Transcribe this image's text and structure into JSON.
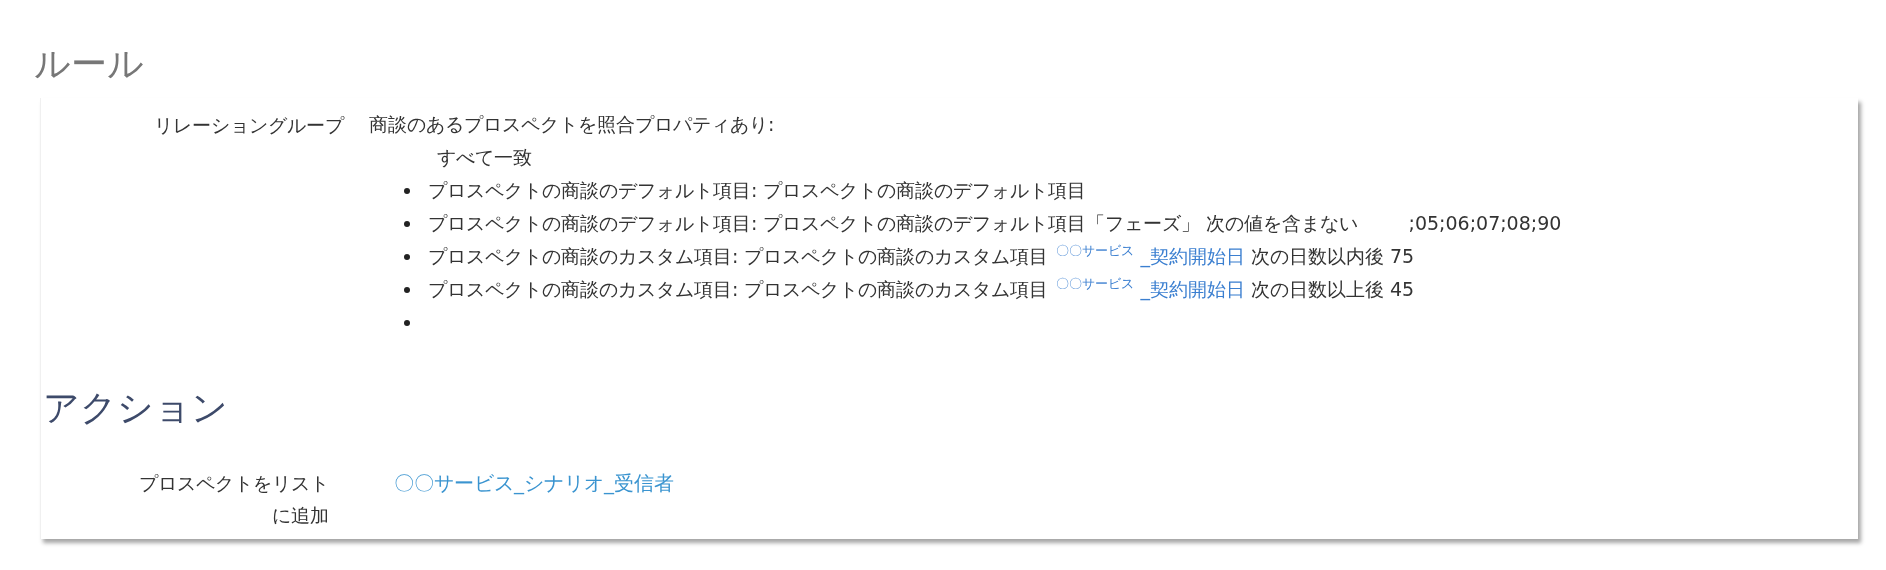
{
  "rules": {
    "title": "ルール",
    "relation": {
      "label": "リレーショングループ",
      "summary": "商談のあるプロスペクトを照合プロパティあり:",
      "match": "すべて一致",
      "items": [
        {
          "kind": "rule",
          "parts": [
            {
              "kind": "text",
              "text": "プロスペクトの商談のデフォルト項目: プロスペクトの商談のデフォルト項目"
            }
          ]
        },
        {
          "kind": "rule",
          "parts": [
            {
              "kind": "text",
              "text": "プロスペクトの商談のデフォルト項目: プロスペクトの商談のデフォルト項目「フェーズ」 次の値を含まない"
            },
            {
              "kind": "value",
              "text": ";05;06;07;08;90"
            }
          ]
        },
        {
          "kind": "rule",
          "parts": [
            {
              "kind": "text",
              "text": "プロスペクトの商談のカスタム項目: プロスペクトの商談のカスタム項目"
            },
            {
              "kind": "note",
              "text": "〇〇サービス"
            },
            {
              "kind": "link",
              "text": "_契約開始日"
            },
            {
              "kind": "text",
              "text": "次の日数以内後 75"
            }
          ]
        },
        {
          "kind": "rule",
          "parts": [
            {
              "kind": "text",
              "text": "プロスペクトの商談のカスタム項目: プロスペクトの商談のカスタム項目"
            },
            {
              "kind": "note",
              "text": "〇〇サービス"
            },
            {
              "kind": "link",
              "text": "_契約開始日"
            },
            {
              "kind": "text",
              "text": "次の日数以上後 45"
            }
          ]
        },
        {
          "kind": "empty"
        }
      ]
    }
  },
  "actions": {
    "title": "アクション",
    "rows": [
      {
        "label": "プロスペクトをリストに追加",
        "value": "〇〇サービス_シナリオ_受信者"
      }
    ]
  }
}
